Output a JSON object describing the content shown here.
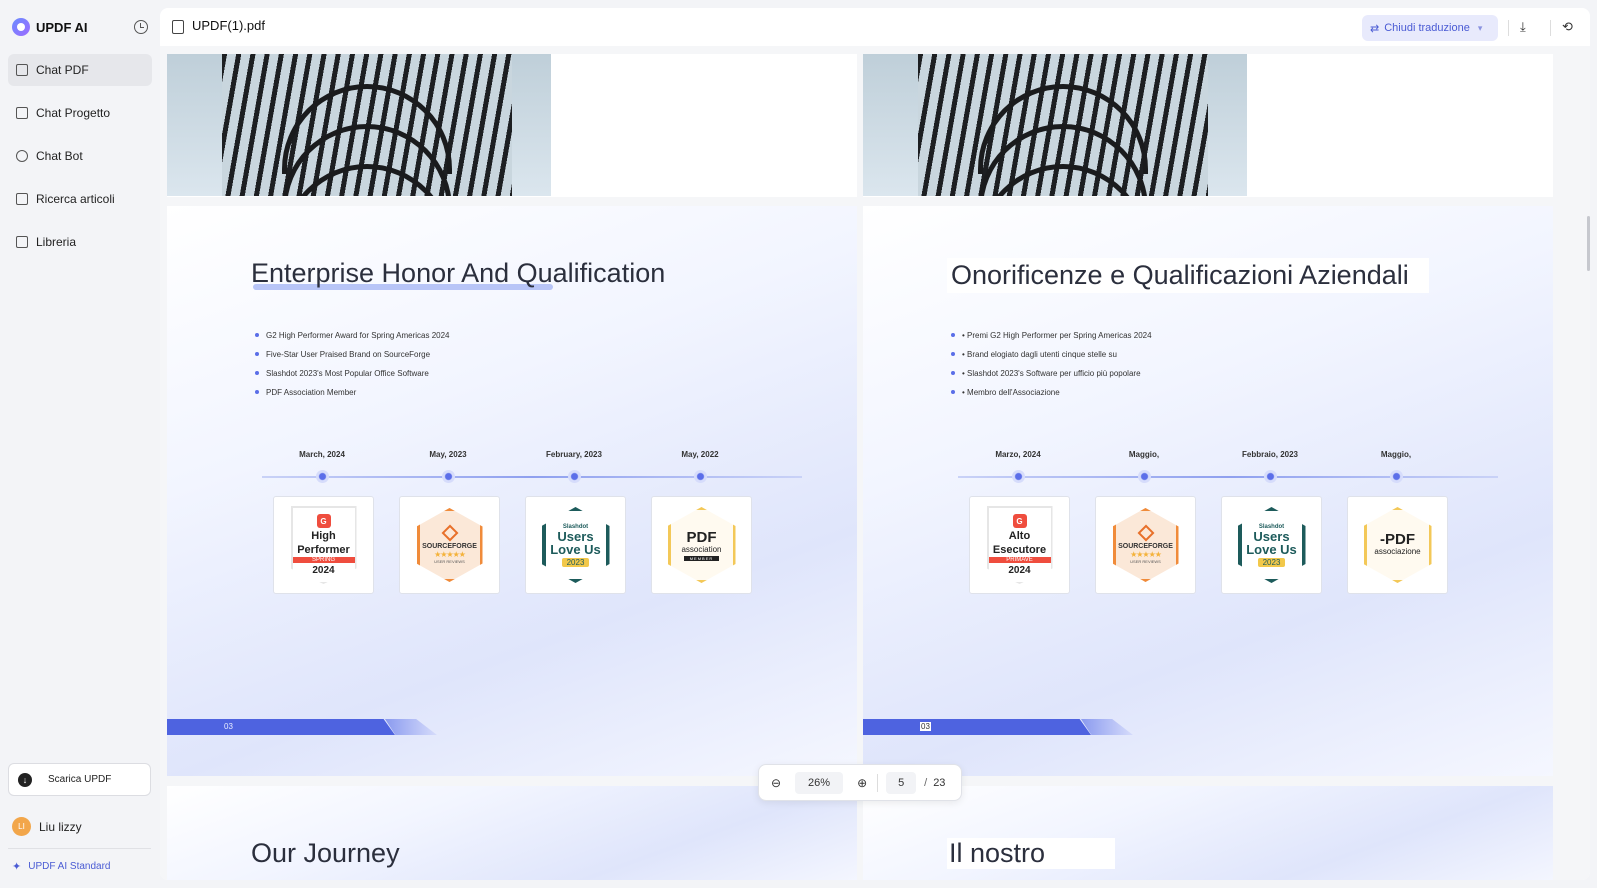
{
  "brand": {
    "name": "UPDF AI"
  },
  "sidebar": {
    "items": [
      {
        "label": "Chat PDF",
        "active": true
      },
      {
        "label": "Chat Progetto"
      },
      {
        "label": "Chat Bot"
      },
      {
        "label": "Ricerca articoli"
      },
      {
        "label": "Libreria"
      }
    ],
    "download_label": "Scarica UPDF",
    "user": {
      "name": "Liu lizzy",
      "initials": "LI"
    },
    "plan_label": "UPDF AI Standard"
  },
  "toolbar": {
    "file_name": "UPDF(1).pdf",
    "translate_label": "Chiudi traduzione"
  },
  "colors": {
    "accent": "#4e63e0",
    "brand": "#6a8cff"
  },
  "original_page": {
    "title": "Enterprise Honor And Qualification",
    "bullets": [
      "G2 High Performer Award for Spring Americas 2024",
      "Five-Star User Praised Brand on SourceForge",
      "Slashdot 2023's Most Popular Office Software",
      "PDF Association Member"
    ],
    "dates": [
      "March, 2024",
      "May, 2023",
      "February, 2023",
      "May, 2022"
    ],
    "badges": {
      "g2_line1": "High",
      "g2_line2": "Performer",
      "g2_band": "SPRING",
      "g2_year": "2024",
      "sf_name": "SOURCEFORGE",
      "sf_stars": "★★★★★",
      "sf_reviews": "USER REVIEWS",
      "sd_brand": "Slashdot",
      "sd_line1": "Users",
      "sd_line2": "Love Us",
      "sd_year": "2023",
      "pa_name": "PDF",
      "pa_sub": "association",
      "pa_member": "MEMBER"
    },
    "page_number": "03",
    "next_title": "Our Journey"
  },
  "translated_page": {
    "title": "Onorificenze e Qualificazioni Aziendali",
    "bullets": [
      "• Premi G2 High Performer per Spring Americas 2024",
      "• Brand elogiato dagli utenti cinque stelle su",
      "• Slashdot 2023's Software per ufficio più popolare",
      "• Membro dell'Associazione"
    ],
    "dates": [
      "Marzo, 2024",
      "Maggio,",
      "Febbraio, 2023",
      "Maggio,"
    ],
    "badges": {
      "g2_line1": "Alto",
      "g2_line2": "Esecutore",
      "g2_band": "PRIMAVE",
      "g2_year": "2024",
      "sf_name": "SOURCEFORGE",
      "sf_stars": "★★★★★",
      "sf_reviews": "USER REVIEWS",
      "sd_brand": "Slashdot",
      "sd_line1": "Users",
      "sd_line2": "Love Us",
      "sd_year": "2023",
      "pa_name": "-PDF",
      "pa_sub": "associazione",
      "pa_member": ""
    },
    "page_number": "03",
    "next_title": "Il nostro"
  },
  "zoom": {
    "value": "26%",
    "page": "5",
    "separator": "/",
    "total": "23"
  }
}
